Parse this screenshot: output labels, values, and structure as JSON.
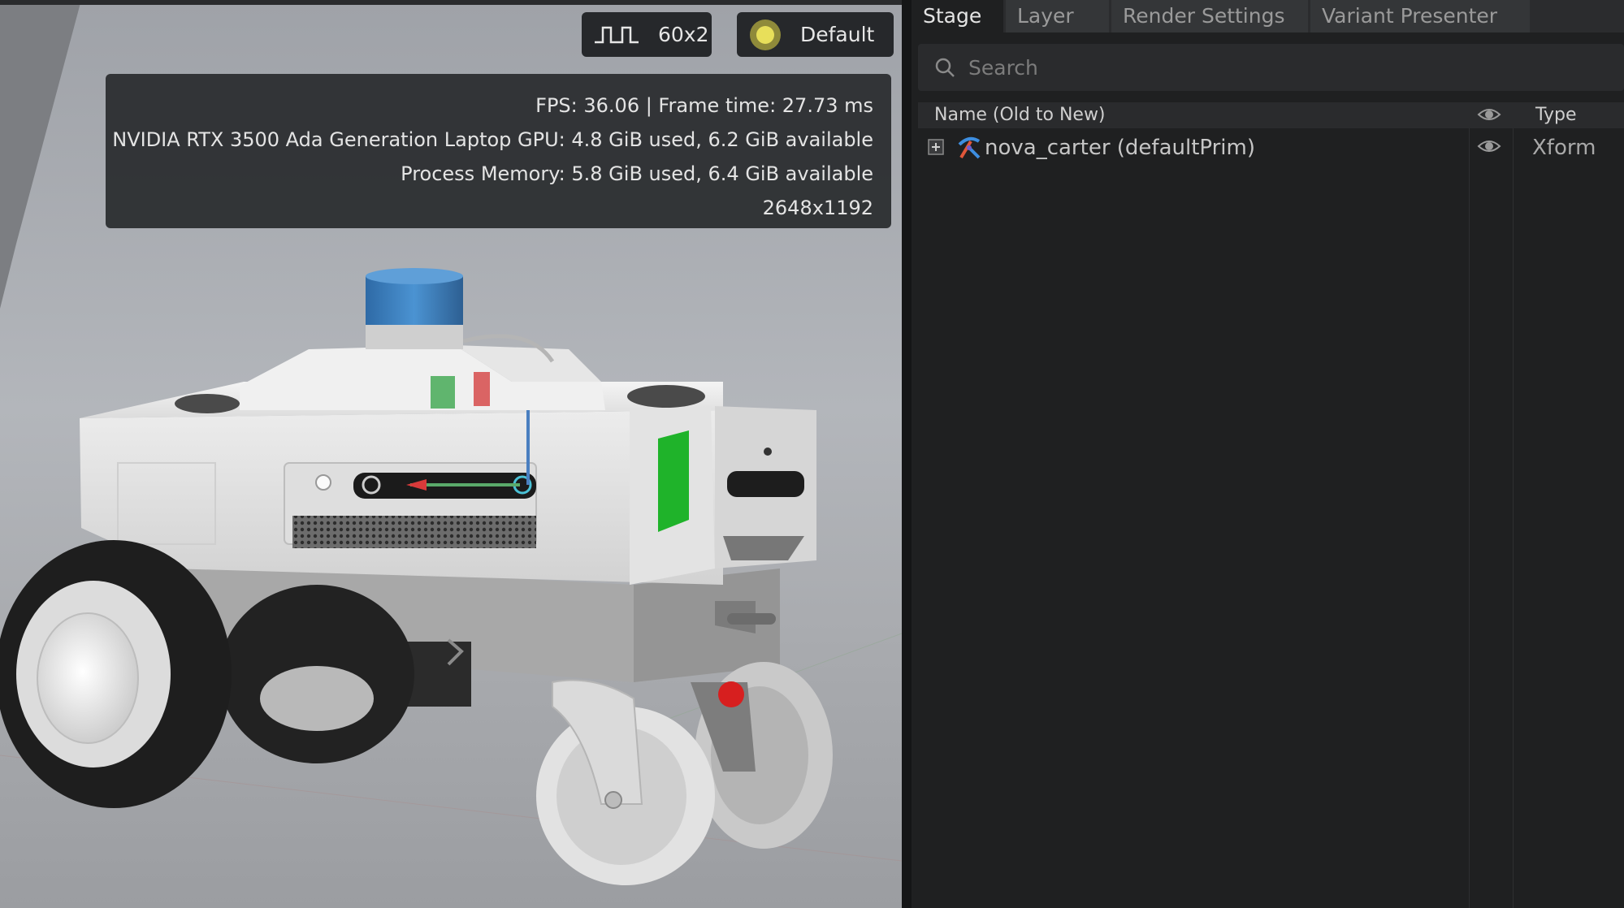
{
  "viewport": {
    "fps_button": {
      "label": "60x2"
    },
    "lighting_button": {
      "label": "Default"
    },
    "stats": {
      "fps_line": "FPS: 36.06 | Frame time: 27.73 ms",
      "gpu_line": "NVIDIA RTX 3500 Ada Generation Laptop GPU: 4.8 GiB used, 6.2 GiB available",
      "memory_line": "Process Memory: 5.8 GiB used, 6.4 GiB available",
      "resolution_line": "2648x1192"
    }
  },
  "panel": {
    "tabs": [
      {
        "label": "Stage",
        "active": true
      },
      {
        "label": "Layer",
        "active": false
      },
      {
        "label": "Render Settings",
        "active": false
      },
      {
        "label": "Variant Presenter",
        "active": false
      }
    ],
    "search": {
      "placeholder": "Search",
      "value": ""
    },
    "columns": {
      "name": "Name (Old to New)",
      "visibility": "eye-icon",
      "type": "Type"
    },
    "rows": [
      {
        "name": "nova_carter (defaultPrim)",
        "type": "Xform",
        "icon": "xform-prim-icon",
        "visible": true
      }
    ]
  },
  "colors": {
    "panel_bg": "#1f2021",
    "tab_inactive": "#343638",
    "stats_bg": "#28292d",
    "lidar_blue": "#3a7fc0",
    "indicator_green": "#1fb32a"
  }
}
